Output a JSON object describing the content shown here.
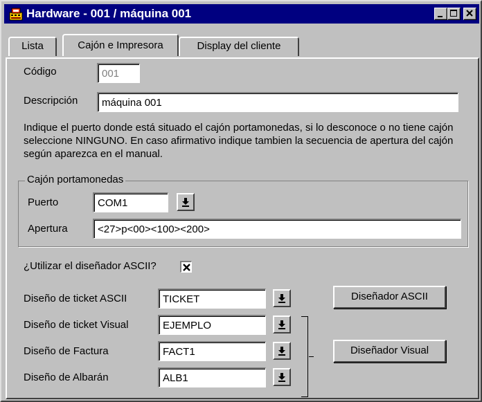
{
  "window": {
    "title": "Hardware - 001 / máquina 001",
    "app_icon": "cash-register-icon",
    "controls": [
      "minimize",
      "maximize",
      "close"
    ]
  },
  "tabs": [
    {
      "label": "Lista",
      "active": false
    },
    {
      "label": "Cajón e Impresora",
      "active": true
    },
    {
      "label": "Display del cliente",
      "active": false
    }
  ],
  "codigo": {
    "label": "Código",
    "value": "001"
  },
  "descripcion": {
    "label": "Descripción",
    "value": "máquina 001"
  },
  "info_text": "Indique el puerto donde está situado el cajón portamonedas, si lo desconoce o no tiene cajón seleccione NINGUNO. En caso afirmativo indique tambien la secuencia de apertura del cajón según aparezca en el manual.",
  "cajon": {
    "legend": "Cajón portamonedas",
    "puerto_label": "Puerto",
    "puerto_value": "COM1",
    "apertura_label": "Apertura",
    "apertura_value": "<27>p<00><100><200>"
  },
  "ascii_checkbox": {
    "label": "¿Utilizar el diseñador ASCII?",
    "checked": true
  },
  "designs": [
    {
      "label": "Diseño de ticket ASCII",
      "value": "TICKET"
    },
    {
      "label": "Diseño de ticket Visual",
      "value": "EJEMPLO"
    },
    {
      "label": "Diseño de Factura",
      "value": "FACT1"
    },
    {
      "label": "Diseño de Albarán",
      "value": "ALB1"
    }
  ],
  "buttons": {
    "ascii_designer": "Diseñador ASCII",
    "visual_designer": "Diseñador Visual"
  }
}
